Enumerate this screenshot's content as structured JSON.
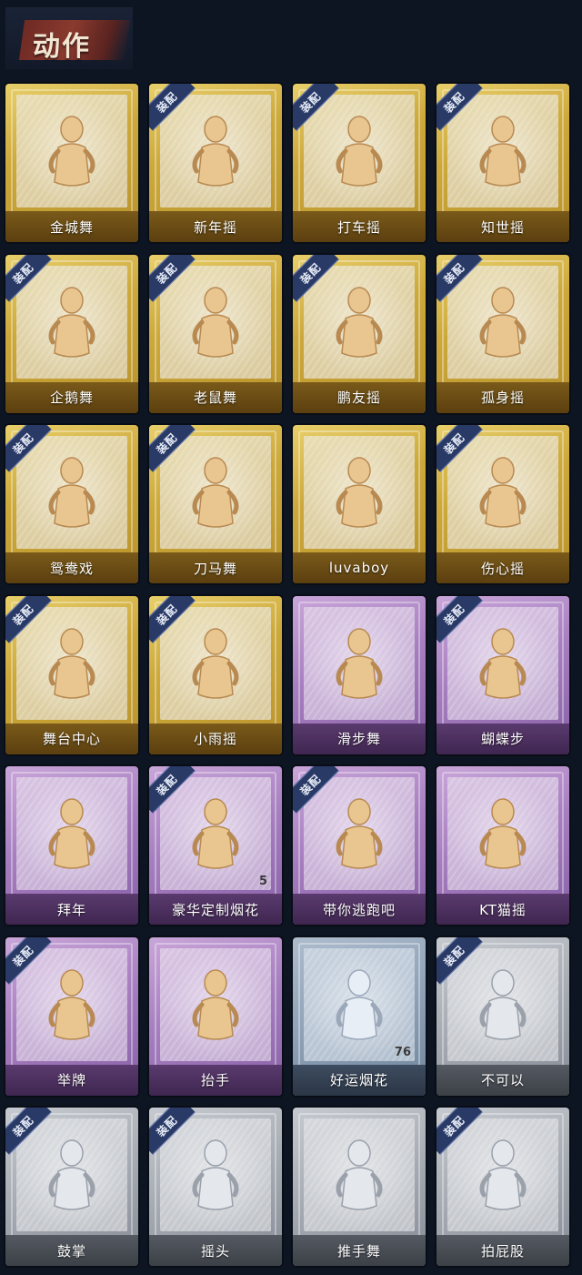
{
  "header": {
    "title": "动作"
  },
  "equip_label": "装配",
  "colors": {
    "gold": "#cda93c",
    "purple": "#a77fc0",
    "blue": "#8da0b6",
    "silver": "#a5aab2"
  },
  "cards": [
    {
      "name": "金城舞",
      "rarity": "gold",
      "equipped": false
    },
    {
      "name": "新年摇",
      "rarity": "gold",
      "equipped": true
    },
    {
      "name": "打车摇",
      "rarity": "gold",
      "equipped": true
    },
    {
      "name": "知世摇",
      "rarity": "gold",
      "equipped": true
    },
    {
      "name": "企鹅舞",
      "rarity": "gold",
      "equipped": true
    },
    {
      "name": "老鼠舞",
      "rarity": "gold",
      "equipped": true
    },
    {
      "name": "鹏友摇",
      "rarity": "gold",
      "equipped": true
    },
    {
      "name": "孤身摇",
      "rarity": "gold",
      "equipped": true
    },
    {
      "name": "鸳鸯戏",
      "rarity": "gold",
      "equipped": true
    },
    {
      "name": "刀马舞",
      "rarity": "gold",
      "equipped": true
    },
    {
      "name": "luvaboy",
      "rarity": "gold",
      "equipped": false
    },
    {
      "name": "伤心摇",
      "rarity": "gold",
      "equipped": true
    },
    {
      "name": "舞台中心",
      "rarity": "gold",
      "equipped": true
    },
    {
      "name": "小雨摇",
      "rarity": "gold",
      "equipped": true
    },
    {
      "name": "滑步舞",
      "rarity": "purple",
      "equipped": false
    },
    {
      "name": "蝴蝶步",
      "rarity": "purple",
      "equipped": true
    },
    {
      "name": "拜年",
      "rarity": "purple",
      "equipped": false
    },
    {
      "name": "豪华定制烟花",
      "rarity": "purple",
      "equipped": true,
      "count": "5"
    },
    {
      "name": "带你逃跑吧",
      "rarity": "purple",
      "equipped": true
    },
    {
      "name": "KT猫摇",
      "rarity": "purple",
      "equipped": false
    },
    {
      "name": "举牌",
      "rarity": "purple",
      "equipped": true
    },
    {
      "name": "抬手",
      "rarity": "purple",
      "equipped": false
    },
    {
      "name": "好运烟花",
      "rarity": "blue",
      "equipped": false,
      "count": "76"
    },
    {
      "name": "不可以",
      "rarity": "silver",
      "equipped": true
    },
    {
      "name": "鼓掌",
      "rarity": "silver",
      "equipped": true
    },
    {
      "name": "摇头",
      "rarity": "silver",
      "equipped": true
    },
    {
      "name": "推手舞",
      "rarity": "silver",
      "equipped": false
    },
    {
      "name": "拍屁股",
      "rarity": "silver",
      "equipped": true
    }
  ]
}
